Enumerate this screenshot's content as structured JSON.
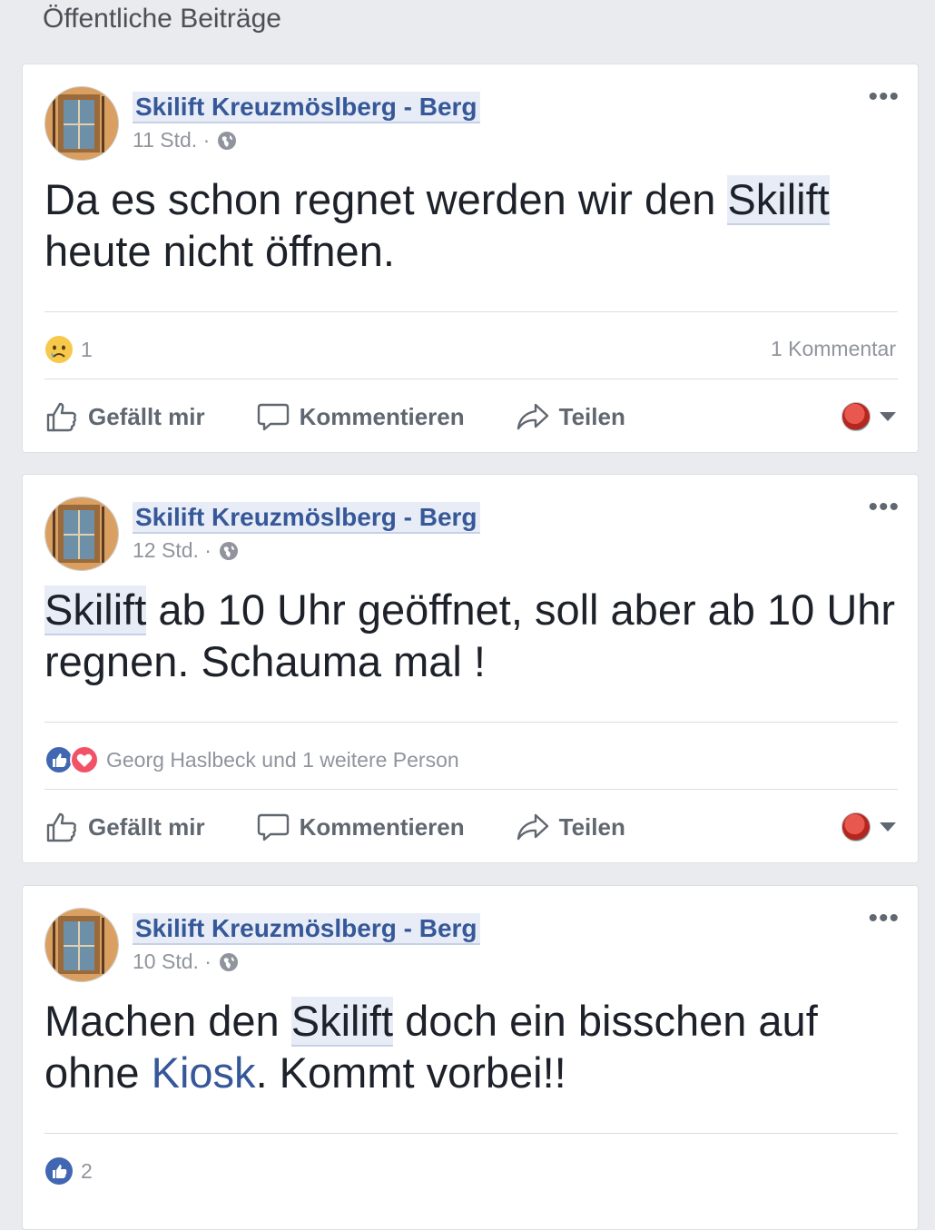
{
  "section_title": "Öffentliche Beiträge",
  "posts": [
    {
      "author": "Skilift Kreuzmöslberg - Berg",
      "time": "11 Std. ·",
      "text_parts": [
        "Da es schon regnet werden wir den ",
        "Skilift",
        " heute nicht öffnen."
      ],
      "reactions_count": "1",
      "comments_count": "1 Kommentar"
    },
    {
      "author": "Skilift Kreuzmöslberg - Berg",
      "time": "12 Std. ·",
      "text_parts": [
        "Skilift",
        " ab 10 Uhr geöffnet, soll aber ab 10 Uhr regnen. Schauma mal !"
      ],
      "reactions_text": "Georg Haslbeck und 1 weitere Person"
    },
    {
      "author": "Skilift Kreuzmöslberg - Berg",
      "time": "10 Std. ·",
      "text_parts": [
        "Machen den ",
        "Skilift",
        " doch ein bisschen auf ohne ",
        "Kiosk",
        ". Kommt vorbei!!"
      ],
      "reactions_count": "2"
    }
  ],
  "actions": {
    "like": "Gefällt mir",
    "comment": "Kommentieren",
    "share": "Teilen"
  },
  "icons": {
    "more": "more-horizontal-icon",
    "globe": "globe-icon",
    "like": "thumbs-up-icon",
    "comment": "speech-bubble-icon",
    "share": "share-arrow-icon",
    "caret": "caret-down-icon"
  },
  "colors": {
    "link": "#365899",
    "like_blue": "#4267b2",
    "love_red": "#f25268",
    "background": "#e9ebee"
  }
}
